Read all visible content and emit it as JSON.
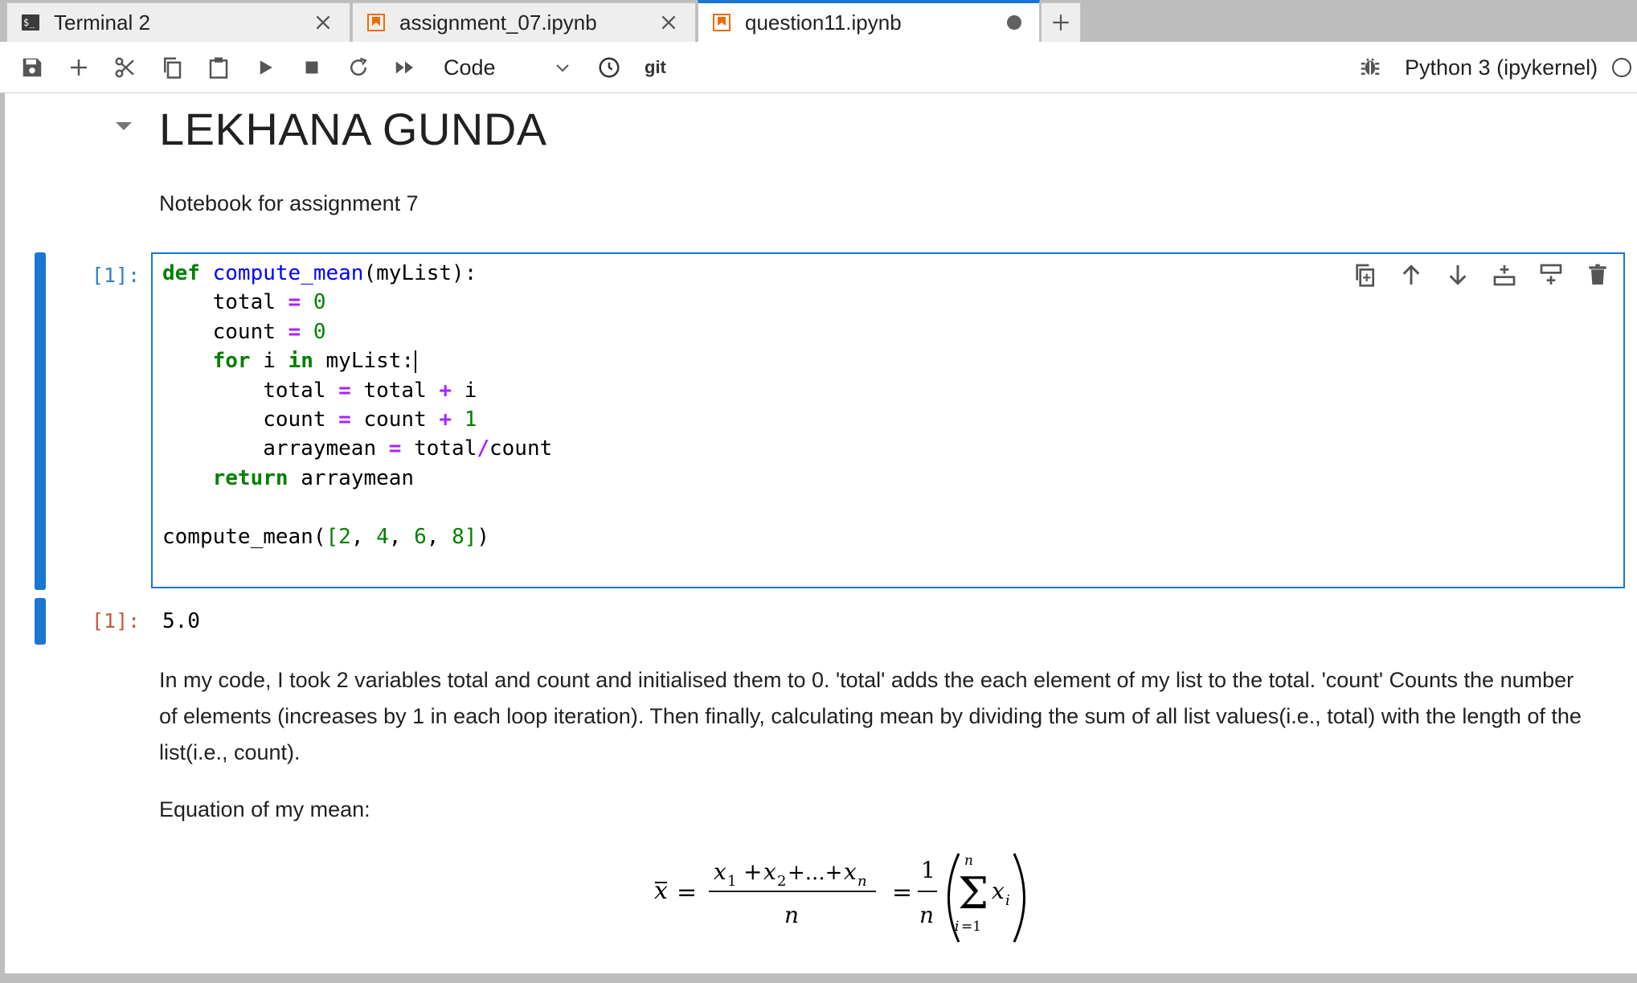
{
  "tabs": [
    {
      "label": "Terminal 2",
      "icon": "terminal-icon"
    },
    {
      "label": "assignment_07.ipynb",
      "icon": "notebook-icon"
    },
    {
      "label": "question11.ipynb",
      "icon": "notebook-icon",
      "active": true
    }
  ],
  "toolbar": {
    "cell_type": "Code",
    "git_label": "git",
    "kernel_name": "Python 3 (ipykernel)"
  },
  "notebook": {
    "title": "LEKHANA GUNDA",
    "subtitle": "Notebook for assignment 7",
    "code_cell": {
      "prompt": "[1]:",
      "source": "def compute_mean(myList):\n    total = 0\n    count = 0\n    for i in myList:\n        total = total + i\n        count = count + 1\n        arraymean = total/count\n    return arraymean\n\ncompute_mean([2, 4, 6, 8])"
    },
    "output_cell": {
      "prompt": "[1]:",
      "value": "5.0"
    },
    "explanation": "In my code, I took 2 variables total and count and initialised them to 0. 'total' adds the each element of my list to the total. 'count' Counts the number of elements (increases by 1 in each loop iteration). Then finally, calculating mean by dividing the sum of all list values(i.e., total) with the length of the list(i.e., count).",
    "equation_label": "Equation of my mean:"
  },
  "colors": {
    "accent": "#1976d2",
    "in_prompt": "#307fc1",
    "out_prompt": "#bf5b3d",
    "keyword": "#008000",
    "function_name": "#0000ff",
    "operator": "#aa22ff"
  }
}
